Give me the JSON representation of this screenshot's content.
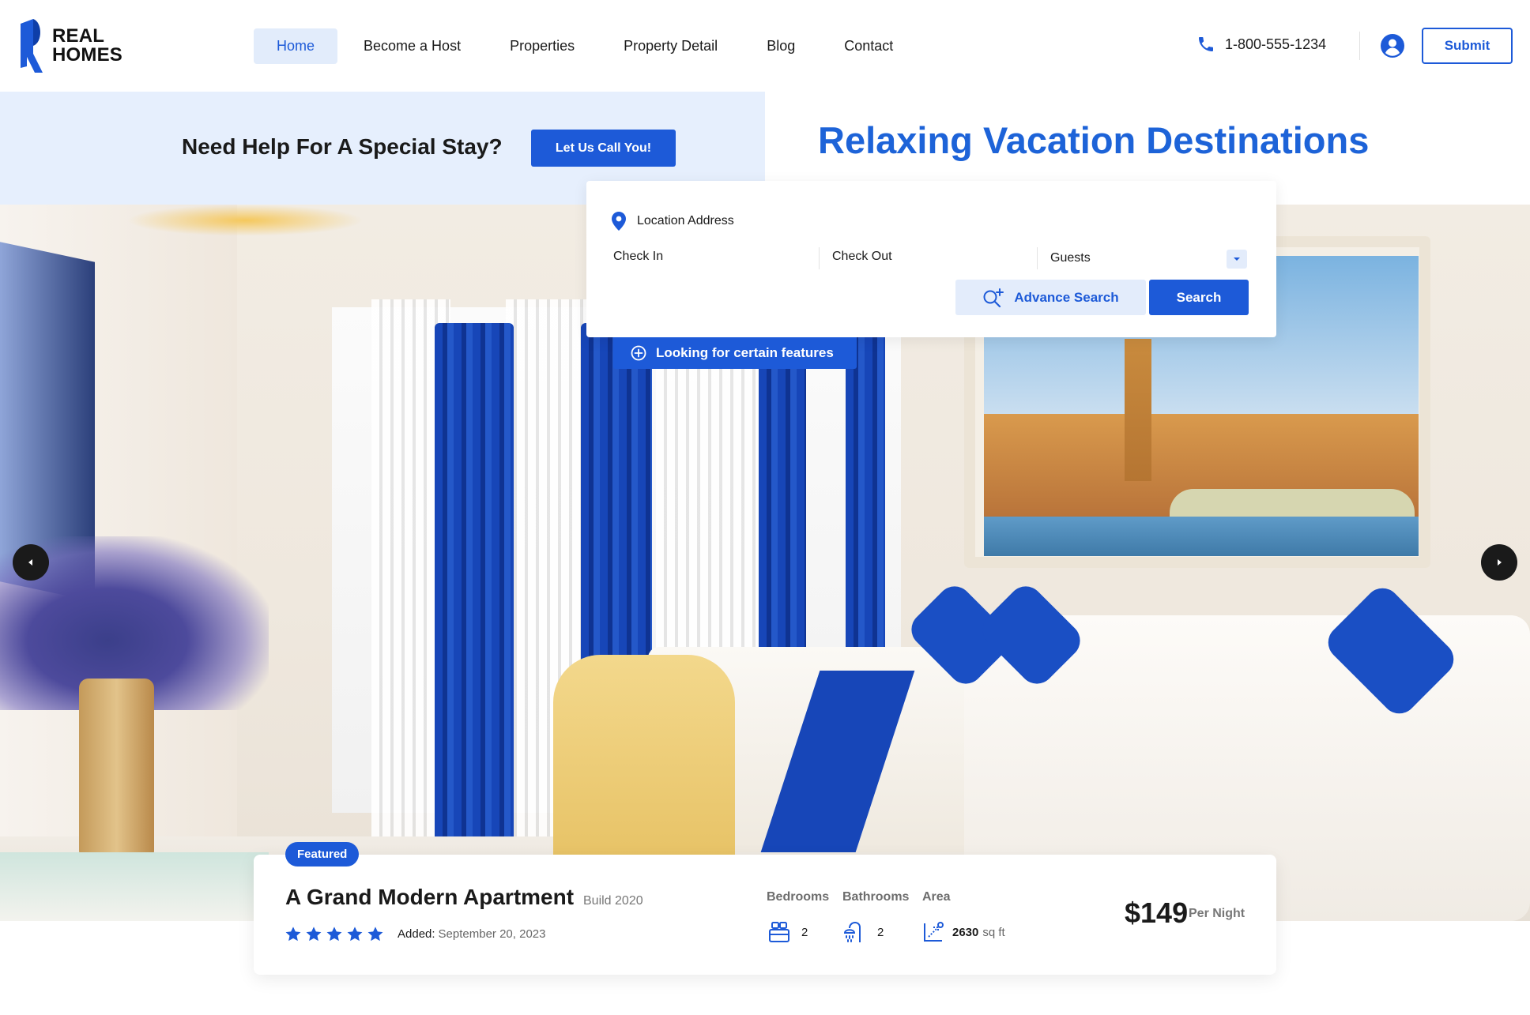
{
  "brand": {
    "line1": "REAL",
    "line2": "HOMES",
    "accent": "#1d5ad8"
  },
  "nav": {
    "items": [
      {
        "label": "Home",
        "active": true
      },
      {
        "label": "Become a Host",
        "active": false
      },
      {
        "label": "Properties",
        "active": false
      },
      {
        "label": "Property Detail",
        "active": false
      },
      {
        "label": "Blog",
        "active": false
      },
      {
        "label": "Contact",
        "active": false
      }
    ]
  },
  "header": {
    "phone": "1-800-555-1234",
    "phone_icon": "phone-icon",
    "user_icon": "user-circle-icon",
    "submit_label": "Submit"
  },
  "help": {
    "text": "Need Help For A Special Stay?",
    "button_label": "Let Us Call You!"
  },
  "hero": {
    "title": "Relaxing Vacation Destinations",
    "prev_icon": "chevron-left-icon",
    "next_icon": "chevron-right-icon"
  },
  "search": {
    "location_label": "Location Address",
    "location_icon": "map-pin-icon",
    "check_in_label": "Check In",
    "check_out_label": "Check Out",
    "guests_label": "Guests",
    "advance_label": "Advance Search",
    "search_label": "Search",
    "features_label": "Looking for certain features"
  },
  "property": {
    "badge": "Featured",
    "title": "A Grand Modern Apartment",
    "build": "Build 2020",
    "rating": 5,
    "added_label": "Added:",
    "added_value": "September 20, 2023",
    "bedrooms_label": "Bedrooms",
    "bedrooms_value": "2",
    "bathrooms_label": "Bathrooms",
    "bathrooms_value": "2",
    "area_label": "Area",
    "area_value": "2630",
    "area_unit": "sq ft",
    "price": "$149",
    "price_unit": "Per Night"
  }
}
